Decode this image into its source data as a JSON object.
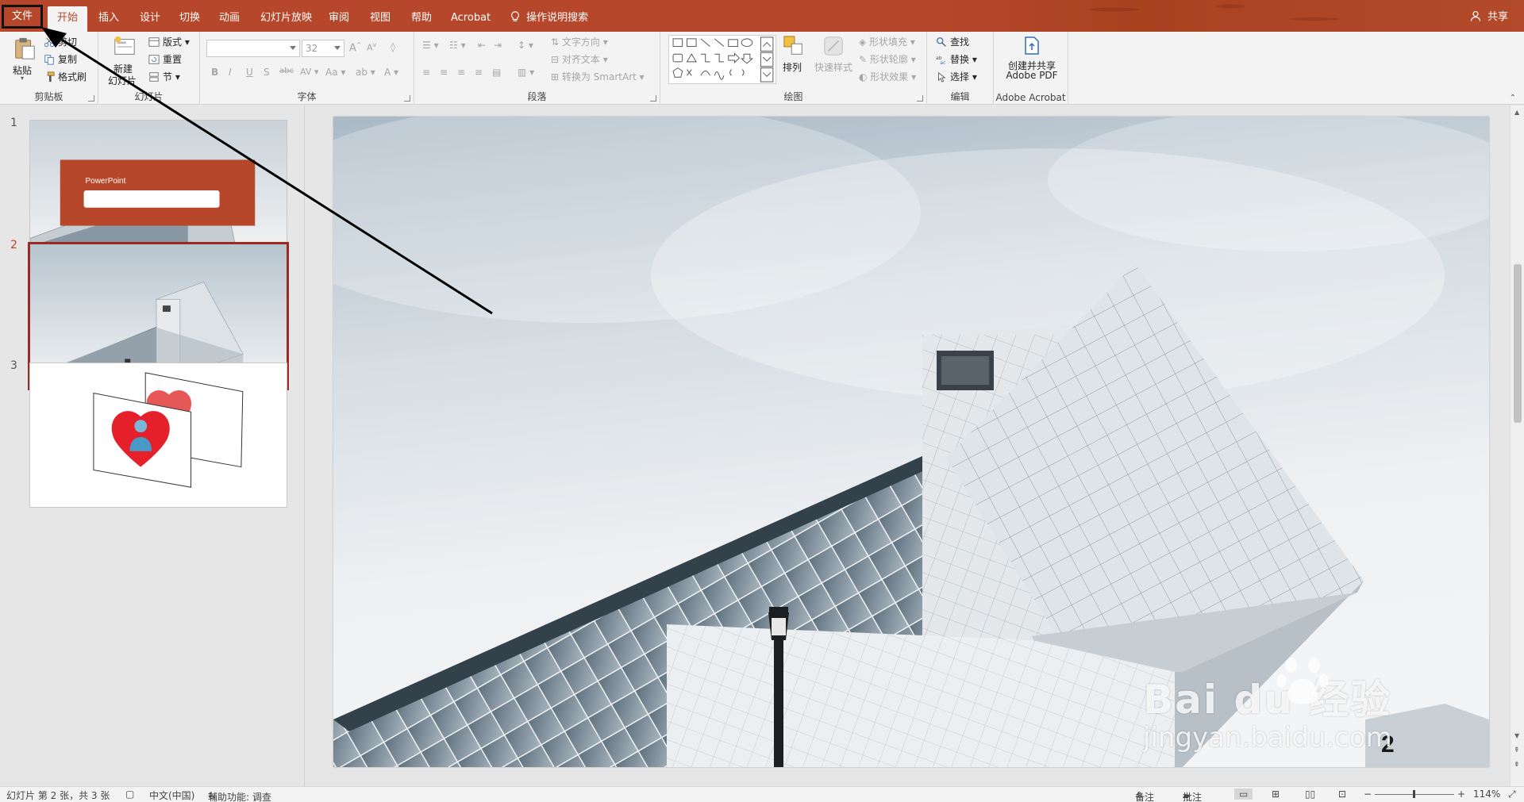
{
  "tabs": {
    "file": "文件",
    "home": "开始",
    "insert": "插入",
    "design": "设计",
    "transitions": "切换",
    "animations": "动画",
    "slideshow": "幻灯片放映",
    "review": "审阅",
    "view": "视图",
    "help": "帮助",
    "acrobat": "Acrobat",
    "tell_me": "操作说明搜索",
    "share": "共享"
  },
  "ribbon": {
    "clipboard": {
      "label": "剪贴板",
      "paste": "粘贴",
      "cut": "剪切",
      "copy": "复制",
      "format_painter": "格式刷"
    },
    "slides": {
      "label": "幻灯片",
      "new_slide": "新建",
      "new_slide2": "幻灯片",
      "layout": "版式",
      "reset": "重置",
      "section": "节"
    },
    "font": {
      "label": "字体",
      "font_size": "32"
    },
    "paragraph": {
      "label": "段落",
      "text_direction": "文字方向",
      "align_text": "对齐文本",
      "convert_smartart": "转换为 SmartArt"
    },
    "drawing": {
      "label": "绘图",
      "arrange": "排列",
      "quick_styles": "快速样式",
      "shape_fill": "形状填充",
      "shape_outline": "形状轮廓",
      "shape_effects": "形状效果"
    },
    "editing": {
      "label": "编辑",
      "find": "查找",
      "replace": "替换",
      "select": "选择"
    },
    "acrobat": {
      "label": "Adobe Acrobat",
      "create_share_1": "创建并共享",
      "create_share_2": "Adobe PDF"
    }
  },
  "slides": [
    {
      "num": "1",
      "title": "PowerPoint"
    },
    {
      "num": "2"
    },
    {
      "num": "3"
    }
  ],
  "slide_page_number": "2",
  "status": {
    "slide_info": "幻灯片 第 2 张，共 3 张",
    "language": "中文(中国)",
    "accessibility": "辅助功能: 调查",
    "notes": "备注",
    "comments": "批注",
    "zoom": "114%"
  },
  "watermark": {
    "brand": "Bai du 经验",
    "url": "jingyan.baidu.com"
  },
  "colors": {
    "accent": "#b7472a",
    "selection": "#9b2a23"
  }
}
